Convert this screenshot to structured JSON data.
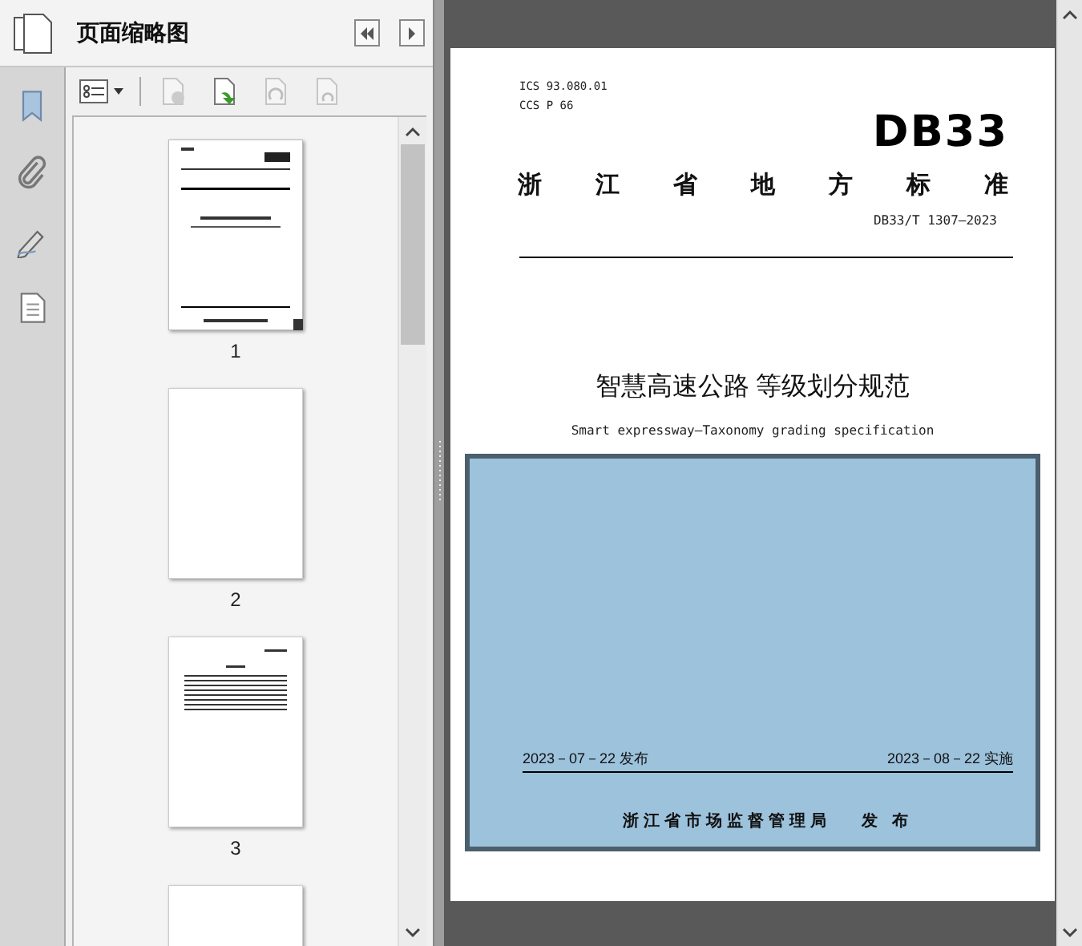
{
  "panel": {
    "title": "页面缩略图"
  },
  "rail": [
    {
      "kind": "bookmark",
      "selected": false
    },
    {
      "kind": "attachment",
      "selected": false
    },
    {
      "kind": "signature",
      "selected": false
    },
    {
      "kind": "page",
      "selected": false
    }
  ],
  "toolbar": [
    {
      "kind": "options",
      "disabled": false
    },
    {
      "kind": "delete",
      "disabled": true
    },
    {
      "kind": "insert",
      "disabled": false
    },
    {
      "kind": "rotate",
      "disabled": true
    },
    {
      "kind": "copy",
      "disabled": true
    }
  ],
  "thumbnails": [
    {
      "label": "1",
      "kind": "cover",
      "selected": true
    },
    {
      "label": "2",
      "kind": "blank",
      "selected": false
    },
    {
      "label": "3",
      "kind": "text",
      "selected": false
    },
    {
      "kind": "blank",
      "selected": false
    }
  ],
  "document": {
    "codes": [
      "ICS 93.080.01",
      "CCS P 66"
    ],
    "logo": "DB33",
    "category": "浙 江 省 地 方 标 准",
    "number": "DB33/T 1307—2023",
    "title": "智慧高速公路 等级划分规范",
    "subtitle": "Smart expressway—Taxonomy grading specification",
    "issue_date": "2023－07－22 发布",
    "effective_date": "2023－08－22 实施",
    "issuer": "浙江省市场监督管理局　 发 布"
  }
}
